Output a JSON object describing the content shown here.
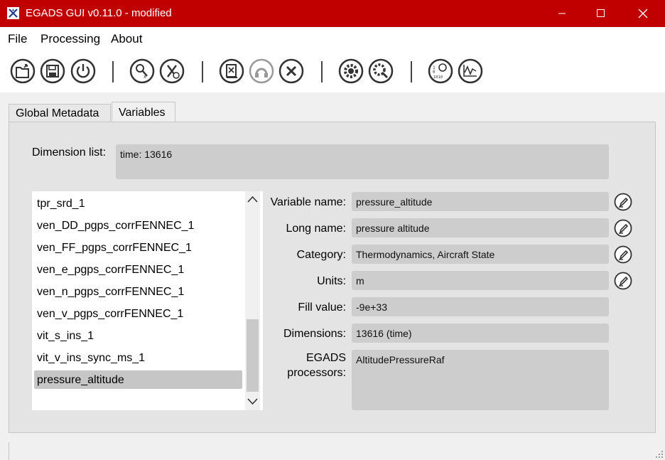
{
  "window": {
    "title": "EGADS GUI v0.11.0 - modified",
    "accent_color": "#c00000",
    "controls": [
      "minimize-icon",
      "maximize-icon",
      "close-icon"
    ]
  },
  "menu": {
    "items": [
      "File",
      "Processing",
      "About"
    ]
  },
  "toolbar": {
    "groups": [
      [
        "open-file-icon",
        "save-file-icon",
        "power-icon"
      ],
      [
        "search-variable-icon",
        "delete-variable-icon"
      ],
      [
        "delete-metadata-icon",
        "undo-icon",
        "close-file-icon"
      ],
      [
        "processing-settings-icon",
        "algorithm-settings-icon"
      ],
      [
        "data-display-icon",
        "plot-icon"
      ]
    ]
  },
  "tabs": [
    {
      "label": "Global Metadata",
      "active": false
    },
    {
      "label": "Variables",
      "active": true
    }
  ],
  "dimension": {
    "label": "Dimension list:",
    "value": "time: 13616"
  },
  "variable_list": {
    "items": [
      "tpr_srd_1",
      "ven_DD_pgps_corrFENNEC_1",
      "ven_FF_pgps_corrFENNEC_1",
      "ven_e_pgps_corrFENNEC_1",
      "ven_n_pgps_corrFENNEC_1",
      "ven_v_pgps_corrFENNEC_1",
      "vit_s_ins_1",
      "vit_v_ins_sync_ms_1",
      "pressure_altitude"
    ],
    "selected": "pressure_altitude"
  },
  "details": {
    "variable_name": {
      "label": "Variable name:",
      "value": "pressure_altitude"
    },
    "long_name": {
      "label": "Long name:",
      "value": "pressure altitude"
    },
    "category": {
      "label": "Category:",
      "value": "Thermodynamics, Aircraft State"
    },
    "units": {
      "label": "Units:",
      "value": "m"
    },
    "fill_value": {
      "label": "Fill value:",
      "value": "-9e+33"
    },
    "dimensions": {
      "label": "Dimensions:",
      "value": "13616 (time)"
    },
    "processors": {
      "label_line1": "EGADS",
      "label_line2": "processors:",
      "value": "AltitudePressureRaf"
    }
  }
}
